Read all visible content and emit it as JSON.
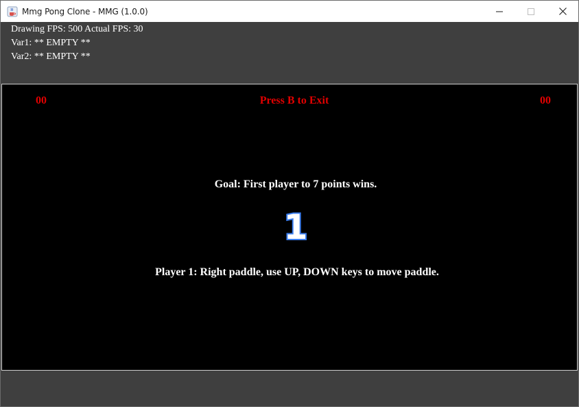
{
  "window": {
    "title": "Mmg Pong Clone - MMG (1.0.0)",
    "icon": "java-cup-icon",
    "controls": {
      "minimize": "minimize-icon",
      "maximize": "maximize-icon",
      "close": "close-icon"
    }
  },
  "debug": {
    "fps_line": "Drawing FPS: 500 Actual FPS: 30",
    "var1_line": "Var1: ** EMPTY **",
    "var2_line": "Var2: ** EMPTY **"
  },
  "game": {
    "score_left": "00",
    "score_right": "00",
    "exit_hint": "Press B to Exit",
    "goal_text": "Goal: First player to 7 points wins.",
    "countdown": "1",
    "player_instructions": "Player 1: Right paddle, use UP, DOWN keys to move paddle."
  },
  "colors": {
    "panel_bg": "#3f3f3f",
    "game_bg": "#000000",
    "score_red": "#e10000",
    "countdown_outline": "#3a7ef0",
    "text_white": "#ffffff"
  }
}
